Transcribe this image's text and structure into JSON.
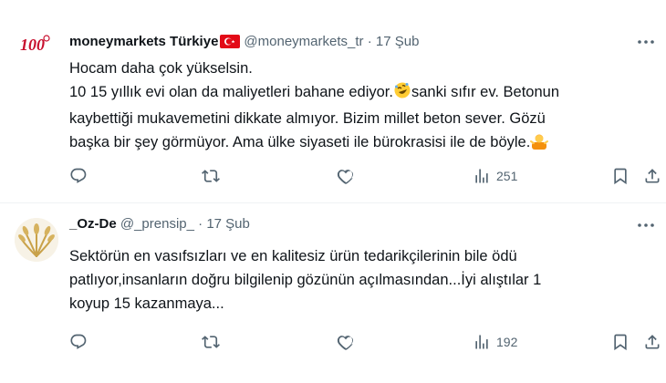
{
  "tweets": [
    {
      "display_name": "moneymarkets Türkiye",
      "handle": "@moneymarkets_tr",
      "separator": "·",
      "date": "17 Şub",
      "avatar_text": "100",
      "lines": [
        "Hocam daha çok yükselsin.",
        "10 15 yıllık evi olan da maliyetleri bahane ediyor.",
        "sanki sıfır ev. Betonun",
        "kaybettiği mukavemetini dikkate almıyor. Bizim millet beton sever. Gözü",
        "başka bir şey görmüyor. Ama ülke siyaseti ile bürokrasisi ile de böyle."
      ],
      "views": "251"
    },
    {
      "display_name": "_Oz-De",
      "handle": "@_prensip_",
      "separator": "·",
      "date": "17 Şub",
      "lines": [
        "Sektörün en vasıfsızları ve en kalitesiz ürün tedarikçilerinin bile ödü",
        "patlıyor,insanların doğru bilgilenip gözünün açılmasından...İyi alıştılar 1",
        "koyup 15 kazanmaya..."
      ],
      "views": "192"
    }
  ],
  "colors": {
    "text": "#0f1419",
    "secondary": "#536471",
    "divider": "#eff3f4",
    "flag_red": "#e30a17",
    "avatar_red": "#c8102e"
  },
  "icons": [
    "reply-icon",
    "retweet-icon",
    "like-icon",
    "views-icon",
    "bookmark-icon",
    "share-icon",
    "more-icon",
    "turkish-flag-icon",
    "rofl-emoji",
    "shrug-emoji"
  ]
}
